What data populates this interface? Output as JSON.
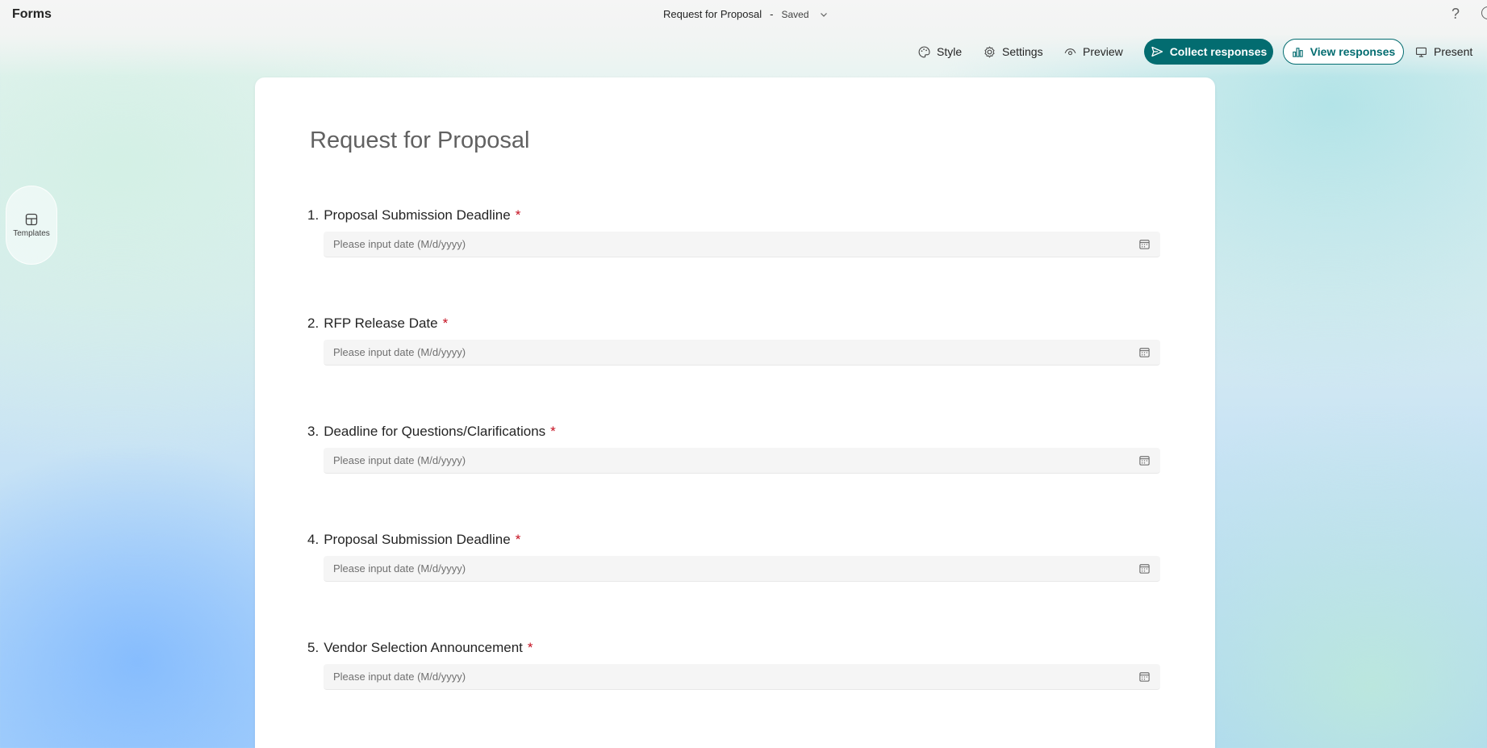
{
  "app": {
    "name": "Forms"
  },
  "header": {
    "doc_title": "Request for Proposal",
    "separator": "-",
    "save_status": "Saved",
    "help_glyph": "?"
  },
  "toolbar": {
    "style": "Style",
    "settings": "Settings",
    "preview": "Preview",
    "collect": "Collect responses",
    "view": "View responses",
    "present": "Present"
  },
  "rail": {
    "templates": "Templates"
  },
  "form": {
    "title": "Request for Proposal",
    "questions": [
      {
        "number": "1.",
        "label": "Proposal Submission Deadline",
        "required": "*",
        "placeholder": "Please input date (M/d/yyyy)"
      },
      {
        "number": "2.",
        "label": "RFP Release Date",
        "required": "*",
        "placeholder": "Please input date (M/d/yyyy)"
      },
      {
        "number": "3.",
        "label": "Deadline for Questions/Clarifications",
        "required": "*",
        "placeholder": "Please input date (M/d/yyyy)"
      },
      {
        "number": "4.",
        "label": "Proposal Submission Deadline",
        "required": "*",
        "placeholder": "Please input date (M/d/yyyy)"
      },
      {
        "number": "5.",
        "label": "Vendor Selection Announcement",
        "required": "*",
        "placeholder": "Please input date (M/d/yyyy)"
      }
    ]
  },
  "colors": {
    "accent": "#036c70",
    "required": "#c50f1f",
    "input_bg": "#f5f5f5"
  },
  "icons": [
    "palette-icon",
    "gear-icon",
    "eye-icon",
    "send-icon",
    "chart-icon",
    "monitor-icon",
    "calendar-icon",
    "templates-icon",
    "help-icon",
    "chevron-down-icon"
  ]
}
